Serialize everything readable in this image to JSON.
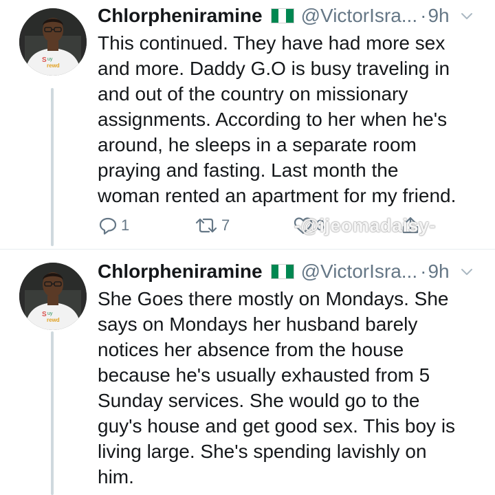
{
  "tweets": [
    {
      "display_name": "Chlorpheniramine",
      "flag_icon": "nigeria-flag-icon",
      "handle": "@VictorIsra...",
      "separator": "·",
      "time": "9h",
      "lines": [
        "This continued. They have had more sex",
        "and more. Daddy G.O is busy traveling in",
        "and out of the country on missionary",
        "assignments. According to her when he's",
        "around, he sleeps in a separate room",
        "praying and fasting. Last month the",
        "woman rented an apartment for my friend."
      ],
      "reply_count": "1",
      "retweet_count": "7",
      "like_count": "3",
      "watermark": "-@ijeomadaisy-"
    },
    {
      "display_name": "Chlorpheniramine",
      "flag_icon": "nigeria-flag-icon",
      "handle": "@VictorIsra...",
      "separator": "·",
      "time": "9h",
      "lines": [
        "She Goes there mostly on Mondays. She",
        "says on Mondays her husband barely",
        "notices her absence from the house",
        "because he's usually exhausted from 5",
        "Sunday services. She would go to the",
        "guy's house and get good sex. This boy is",
        "living large. She's spending lavishly on",
        "him."
      ]
    }
  ],
  "colors": {
    "text": "#14171a",
    "secondary": "#657786",
    "thread_line": "#cfd9de",
    "flag_green": "#008751",
    "shirt": "#f2f2f2",
    "skin": "#5a3a26"
  }
}
